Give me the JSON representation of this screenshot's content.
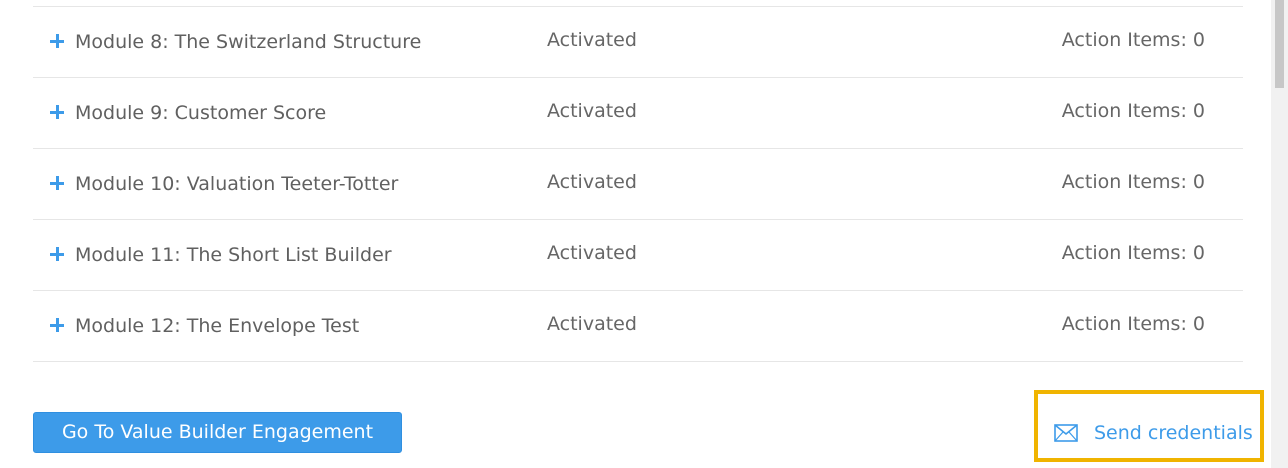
{
  "modules": [
    {
      "title": "Module 8: The Switzerland Structure",
      "status": "Activated",
      "actions": "Action Items: 0"
    },
    {
      "title": "Module 9: Customer Score",
      "status": "Activated",
      "actions": "Action Items: 0"
    },
    {
      "title": "Module 10: Valuation Teeter-Totter",
      "status": "Activated",
      "actions": "Action Items: 0"
    },
    {
      "title": "Module 11: The Short List Builder",
      "status": "Activated",
      "actions": "Action Items: 0"
    },
    {
      "title": "Module 12: The Envelope Test",
      "status": "Activated",
      "actions": "Action Items: 0"
    }
  ],
  "footer": {
    "engagement_button": "Go To Value Builder Engagement",
    "send_credentials": "Send credentials"
  },
  "icons": {
    "expand": "plus-icon",
    "mail": "envelope-icon"
  },
  "colors": {
    "accent": "#3d9be9",
    "highlight": "#f0b400",
    "text": "#666666"
  }
}
